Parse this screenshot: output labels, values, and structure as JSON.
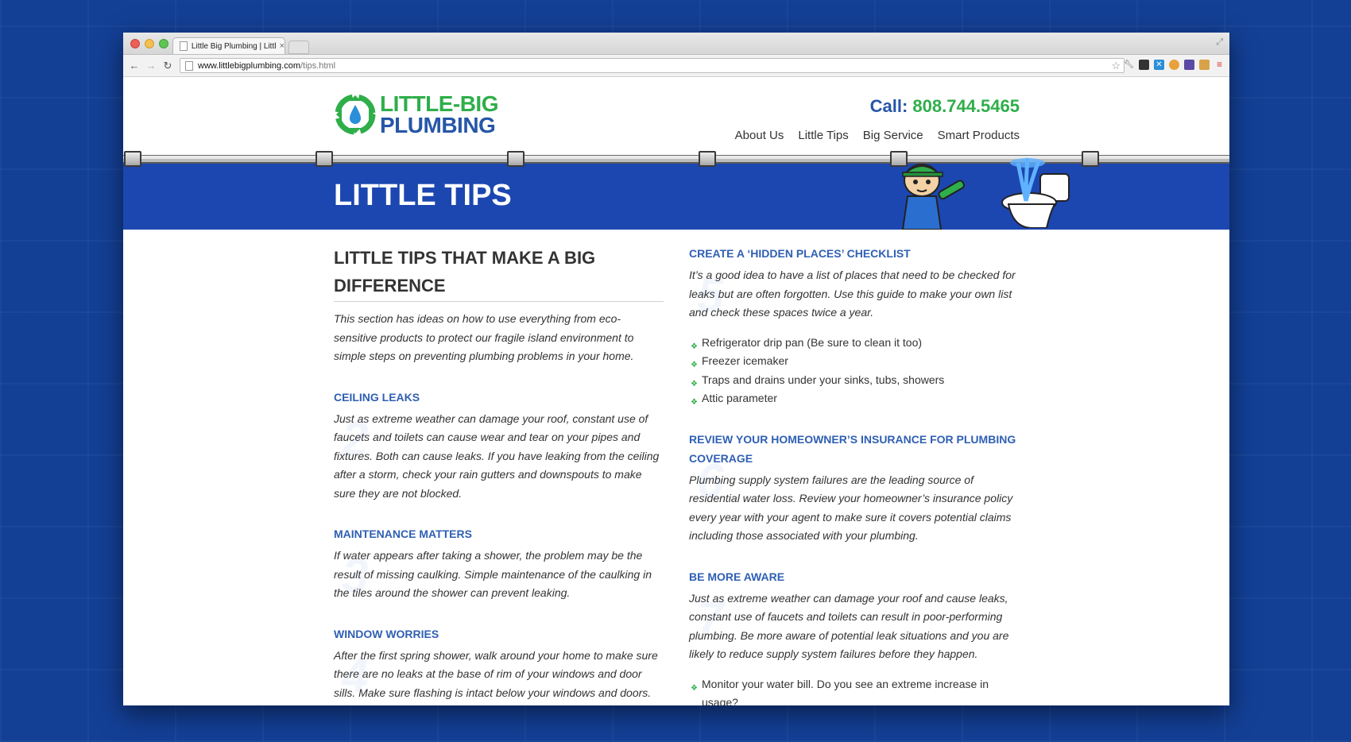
{
  "browser": {
    "tab_title": "Little Big Plumbing | Little",
    "tab_close": "×",
    "url_host": "www.littlebigplumbing.com",
    "url_path": "/tips.html"
  },
  "site": {
    "logo_line1": "LITTLE-BIG",
    "logo_line2": "PLUMBING",
    "call_label": "Call:",
    "call_number": "808.744.5465",
    "nav": [
      "About Us",
      "Little Tips",
      "Big Service",
      "Smart Products"
    ],
    "banner_title": "LITTLE TIPS"
  },
  "left": {
    "heading": "LITTLE TIPS THAT MAKE A BIG DIFFERENCE",
    "intro": "This section has ideas on how to use everything from eco-sensitive products to protect our fragile island environment to simple steps on preventing plumbing problems in your home.",
    "tips": [
      {
        "num": "2",
        "title": "CEILING LEAKS",
        "body": "Just as extreme weather can damage your roof, constant use of faucets and toilets can cause wear and tear on your pipes and fixtures. Both can cause leaks. If you have leaking from the ceiling after a storm, check your rain gutters and downspouts to make sure they are not blocked."
      },
      {
        "num": "3",
        "title": "MAINTENANCE MATTERS",
        "body": "If water appears after taking a shower, the problem may be the result of missing caulking. Simple maintenance of the caulking in the tiles around the shower can prevent leaking."
      },
      {
        "num": "4",
        "title": "WINDOW WORRIES",
        "body": "After the first spring shower, walk around your home to make sure there are no leaks at the base of rim of your windows and door sills. Make sure flashing is intact below your windows and doors."
      }
    ]
  },
  "right": {
    "tips": [
      {
        "num": "5",
        "title": "CREATE A ‘HIDDEN PLACES’ CHECKLIST",
        "body": "It’s a good idea to have a list of places that need to be checked for leaks but are often forgotten. Use this guide to make your own list and check these spaces twice a year.",
        "bullets": [
          "Refrigerator drip pan (Be sure to clean it too)",
          "Freezer icemaker",
          "Traps and drains under your sinks, tubs, showers",
          "Attic parameter"
        ]
      },
      {
        "num": "6",
        "title": "REVIEW YOUR HOMEOWNER’S INSURANCE FOR PLUMBING COVERAGE",
        "body": "Plumbing supply system failures are the leading source of residential water loss. Review your homeowner’s insurance policy every year with your agent to make sure it covers potential claims including those associated with your plumbing."
      },
      {
        "num": "7",
        "title": "BE MORE AWARE",
        "body": "Just as extreme weather can damage your roof and cause leaks, constant use of faucets and toilets can result in poor-performing plumbing. Be more aware of potential leak situations and you are likely to reduce supply system failures before they happen.",
        "bullets": [
          "Monitor your water bill. Do you see an extreme increase in usage?"
        ]
      }
    ]
  },
  "colors": {
    "brand_green": "#2fae4a",
    "brand_blue": "#2656a8",
    "banner_blue": "#1c47b0",
    "tip_title": "#2f5fb3"
  }
}
